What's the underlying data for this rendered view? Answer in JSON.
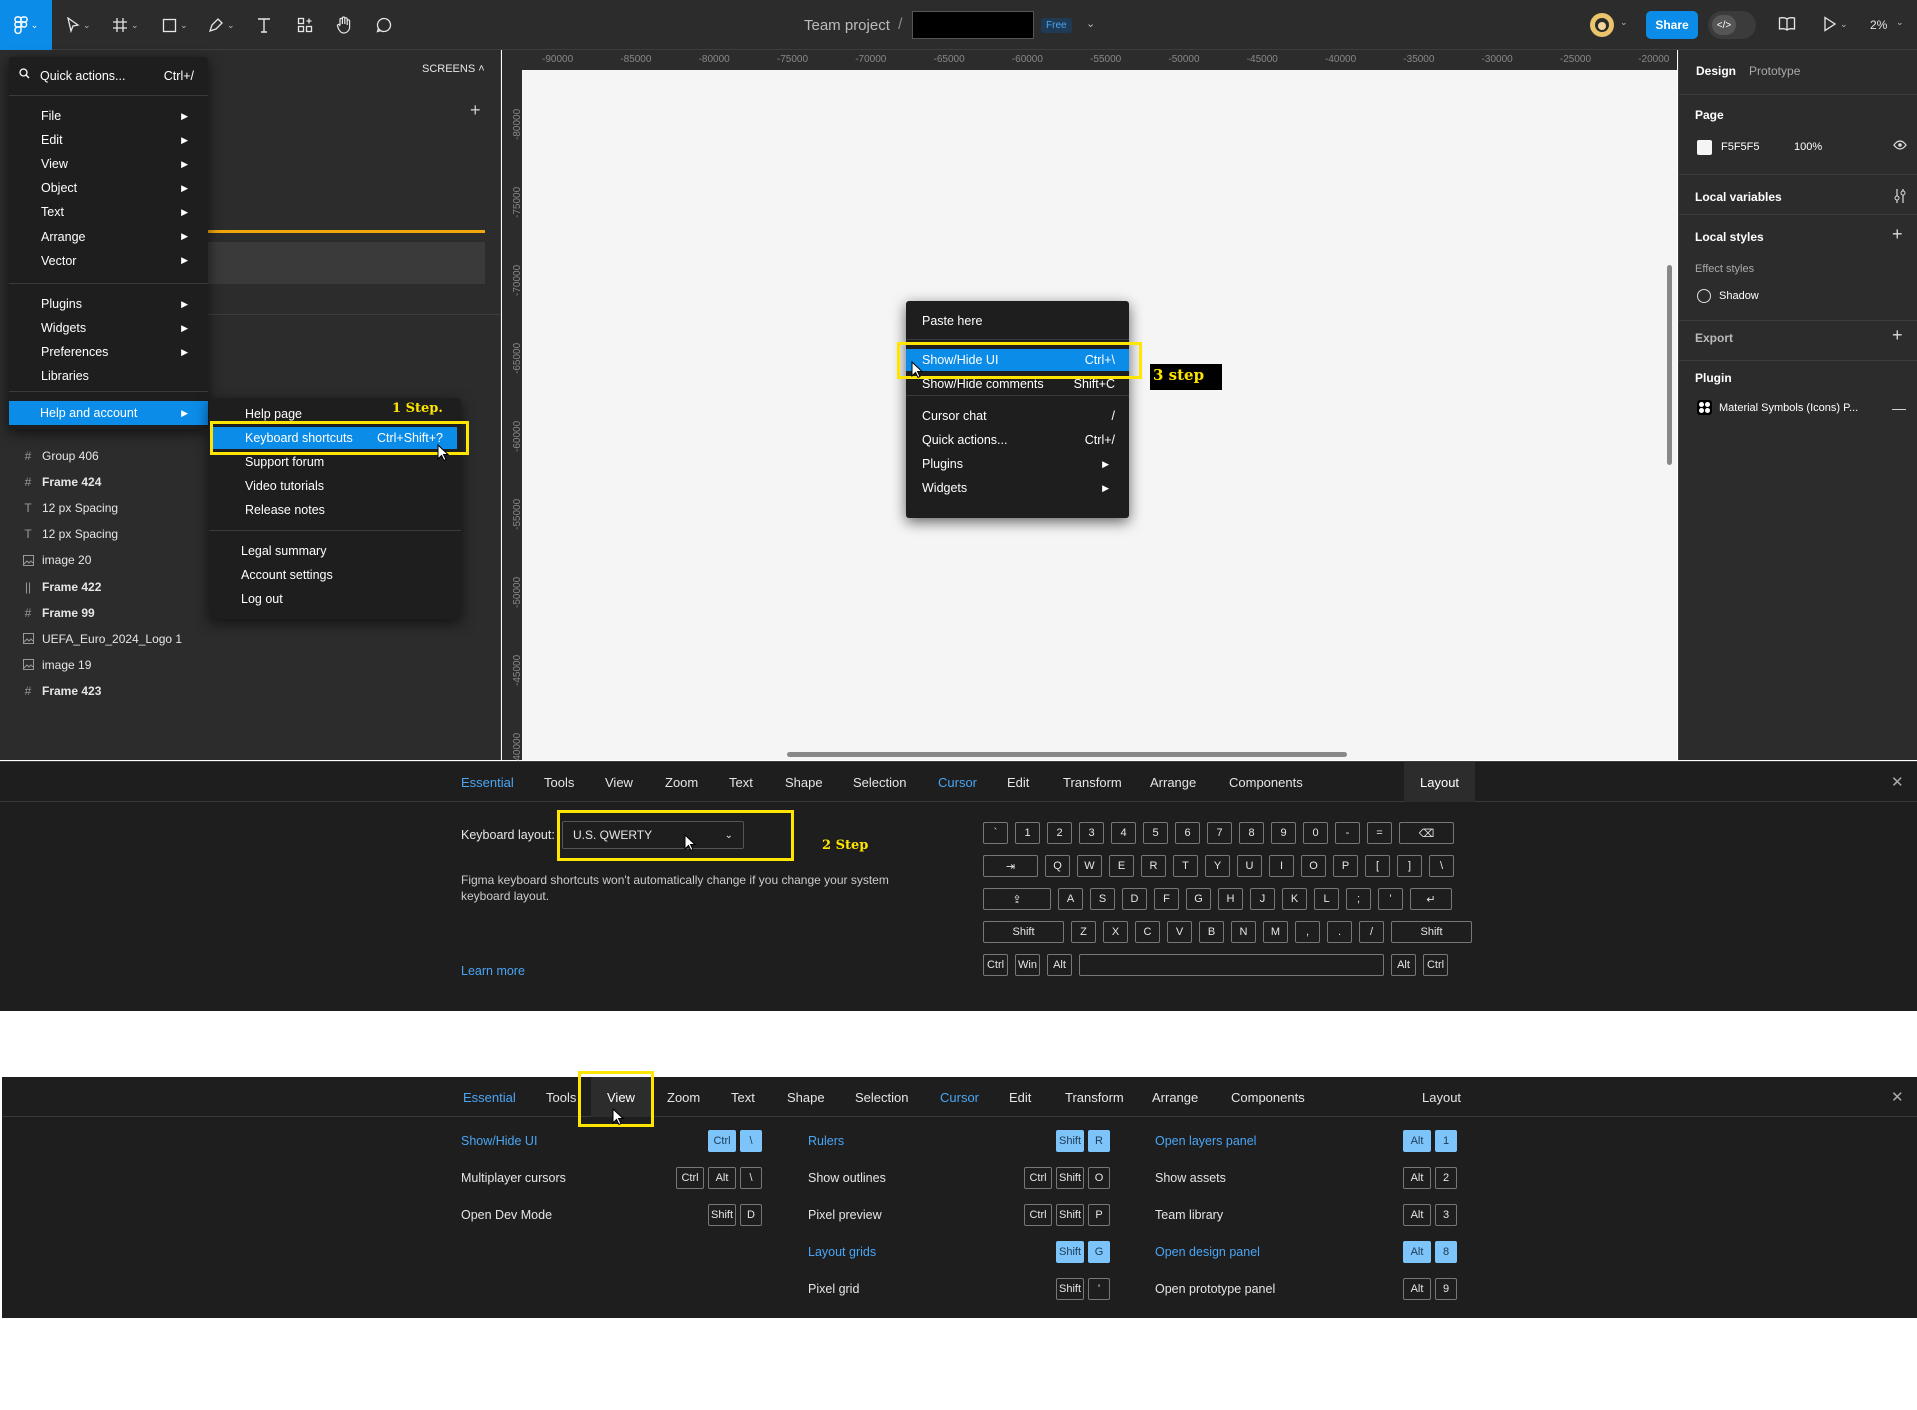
{
  "toolbar": {
    "project": "Team project",
    "separator": "/",
    "plan_badge": "Free",
    "share_label": "Share",
    "zoom": "2%"
  },
  "left_panel": {
    "screens_label": "SCREENS ˄",
    "layers": [
      {
        "label": "Group 406",
        "icon": "#",
        "bold": false
      },
      {
        "label": "Frame 424",
        "icon": "#",
        "bold": true
      },
      {
        "label": "12 px Spacing",
        "icon": "T",
        "bold": false
      },
      {
        "label": "12 px Spacing",
        "icon": "T",
        "bold": false
      },
      {
        "label": "image 20",
        "icon": "img",
        "bold": false
      },
      {
        "label": "Frame 422",
        "icon": "||",
        "bold": true
      },
      {
        "label": "Frame 99",
        "icon": "#",
        "bold": true
      },
      {
        "label": "UEFA_Euro_2024_Logo 1",
        "icon": "img",
        "bold": false
      },
      {
        "label": "image 19",
        "icon": "img",
        "bold": false
      },
      {
        "label": "Frame 423",
        "icon": "#",
        "bold": true
      }
    ]
  },
  "main_menu": {
    "quick_actions": "Quick actions...",
    "quick_actions_shortcut": "Ctrl+/",
    "items": [
      "File",
      "Edit",
      "View",
      "Object",
      "Text",
      "Arrange",
      "Vector"
    ],
    "items2": [
      "Plugins",
      "Widgets",
      "Preferences",
      "Libraries"
    ],
    "help": "Help and account"
  },
  "help_menu": {
    "items": [
      "Help page",
      "Keyboard shortcuts",
      "Support forum",
      "Video tutorials",
      "Release notes"
    ],
    "keyboard_shortcut": "Ctrl+Shift+?",
    "items2": [
      "Legal summary",
      "Account settings",
      "Log out"
    ]
  },
  "context_menu": {
    "paste": "Paste here",
    "items": [
      {
        "label": "Show/Hide UI",
        "shortcut": "Ctrl+\\"
      },
      {
        "label": "Show/Hide comments",
        "shortcut": "Shift+C"
      }
    ],
    "items2": [
      {
        "label": "Cursor chat",
        "shortcut": "/"
      },
      {
        "label": "Quick actions...",
        "shortcut": "Ctrl+/"
      },
      {
        "label": "Plugins",
        "shortcut": "▶"
      },
      {
        "label": "Widgets",
        "shortcut": "▶"
      }
    ]
  },
  "ruler": {
    "h": [
      "-90000",
      "-85000",
      "-80000",
      "-75000",
      "-70000",
      "-65000",
      "-60000",
      "-55000",
      "-50000",
      "-45000",
      "-40000",
      "-35000",
      "-30000",
      "-25000",
      "-20000"
    ],
    "v": [
      "-80000",
      "-75000",
      "-70000",
      "-65000",
      "-60000",
      "-55000",
      "-50000",
      "-45000",
      "-40000"
    ]
  },
  "right_panel": {
    "tab_design": "Design",
    "tab_prototype": "Prototype",
    "page": "Page",
    "page_color": "F5F5F5",
    "page_opacity": "100%",
    "local_variables": "Local variables",
    "local_styles": "Local styles",
    "effect_styles": "Effect styles",
    "shadow": "Shadow",
    "export": "Export",
    "plugin": "Plugin",
    "plugin_name": "Material Symbols (Icons) P..."
  },
  "tabs": [
    "Essential",
    "Tools",
    "View",
    "Zoom",
    "Text",
    "Shape",
    "Selection",
    "Cursor",
    "Edit",
    "Transform",
    "Arrange",
    "Components",
    "Layout"
  ],
  "layout_panel": {
    "keyboard_label": "Keyboard layout:",
    "keyboard_value": "U.S. QWERTY",
    "note": "Figma keyboard shortcuts won't automatically change if you change your system keyboard layout.",
    "learn_more": "Learn more",
    "row1": [
      "`",
      "1",
      "2",
      "3",
      "4",
      "5",
      "6",
      "7",
      "8",
      "9",
      "0",
      "-",
      "=",
      "⌫"
    ],
    "row2": [
      "⇥",
      "Q",
      "W",
      "E",
      "R",
      "T",
      "Y",
      "U",
      "I",
      "O",
      "P",
      "[",
      "]",
      "\\"
    ],
    "row3": [
      "⇪",
      "A",
      "S",
      "D",
      "F",
      "G",
      "H",
      "J",
      "K",
      "L",
      ";",
      "'",
      "↵"
    ],
    "row4": [
      "Shift",
      "Z",
      "X",
      "C",
      "V",
      "B",
      "N",
      "M",
      ",",
      ".",
      "/",
      "Shift"
    ],
    "row5": [
      "Ctrl",
      "Win",
      "Alt",
      "",
      "Alt",
      "Ctrl"
    ]
  },
  "view_panel": {
    "col1": [
      {
        "label": "Show/Hide UI",
        "keys": [
          "Ctrl",
          "\\"
        ],
        "active": true
      },
      {
        "label": "Multiplayer cursors",
        "keys": [
          "Ctrl",
          "Alt",
          "\\"
        ],
        "active": false
      },
      {
        "label": "Open Dev Mode",
        "keys": [
          "Shift",
          "D"
        ],
        "active": false
      }
    ],
    "col2": [
      {
        "label": "Rulers",
        "keys": [
          "Shift",
          "R"
        ],
        "active": true
      },
      {
        "label": "Show outlines",
        "keys": [
          "Ctrl",
          "Shift",
          "O"
        ],
        "active": false
      },
      {
        "label": "Pixel preview",
        "keys": [
          "Ctrl",
          "Shift",
          "P"
        ],
        "active": false
      },
      {
        "label": "Layout grids",
        "keys": [
          "Shift",
          "G"
        ],
        "active": true
      },
      {
        "label": "Pixel grid",
        "keys": [
          "Shift",
          "'"
        ],
        "active": false
      }
    ],
    "col3": [
      {
        "label": "Open layers panel",
        "keys": [
          "Alt",
          "1"
        ],
        "active": true
      },
      {
        "label": "Show assets",
        "keys": [
          "Alt",
          "2"
        ],
        "active": false
      },
      {
        "label": "Team library",
        "keys": [
          "Alt",
          "3"
        ],
        "active": false
      },
      {
        "label": "Open design panel",
        "keys": [
          "Alt",
          "8"
        ],
        "active": true
      },
      {
        "label": "Open prototype panel",
        "keys": [
          "Alt",
          "9"
        ],
        "active": false
      }
    ]
  },
  "annotations": {
    "step1": "1 Step.",
    "step2": "2 Step",
    "step3": "3 step"
  },
  "colors": {
    "accent": "#0c8ce9",
    "highlight": "#ffe500"
  }
}
